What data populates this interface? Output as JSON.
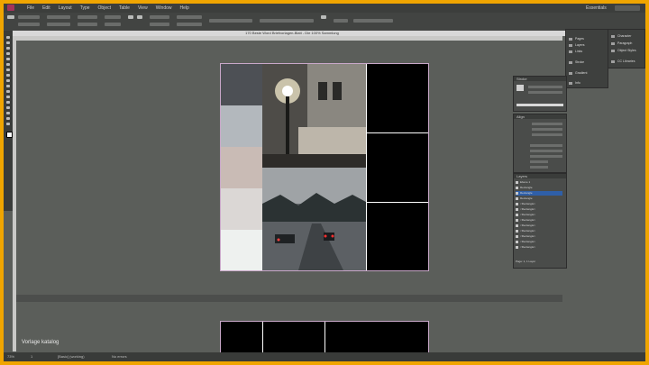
{
  "app": {
    "title_bar_text": "170 Beste Word Briefvorlagen-Blatt - Die 100% Sammlung",
    "menu_items": [
      "File",
      "Edit",
      "Layout",
      "Type",
      "Object",
      "Table",
      "View",
      "Window",
      "Help"
    ],
    "workspace": "Essentials",
    "zoom": "73%"
  },
  "document": {
    "name": "Vorlage katalog",
    "swatch_colors": [
      "#4d5055",
      "#b3b8bd",
      "#c9bbb5",
      "#dbd7d5",
      "#eef1ef"
    ]
  },
  "window_menu": {
    "items": [
      "Pages",
      "Layers",
      "Links",
      "Stroke",
      "Color",
      "Swatches",
      "Effects",
      "Gradient",
      "Info"
    ],
    "right_items": [
      "Character",
      "Paragraph",
      "Object Styles",
      "CC Libraries"
    ]
  },
  "panels": {
    "properties_title": "Stroke",
    "align_title": "Align",
    "layers_title": "Layers",
    "layers": [
      "Ebene 1",
      "Rectangle",
      "Rectangle",
      "Rectangle",
      "<Rectangle>",
      "<Rectangle>",
      "<Rectangle>",
      "<Rectangle>",
      "<Rectangle>",
      "<Rectangle>",
      "<Rectangle>",
      "<Rectangle>",
      "<Rectangle>"
    ],
    "layers_footer": "Page: 1, 1 Layer"
  },
  "status": {
    "page": "1",
    "mode": "[Basic] (working)",
    "errors": "No errors"
  },
  "colors": {
    "accent_border": "#f0a500",
    "pasteboard": "#5b5e5a",
    "page_frame": "#c9a8c9"
  }
}
